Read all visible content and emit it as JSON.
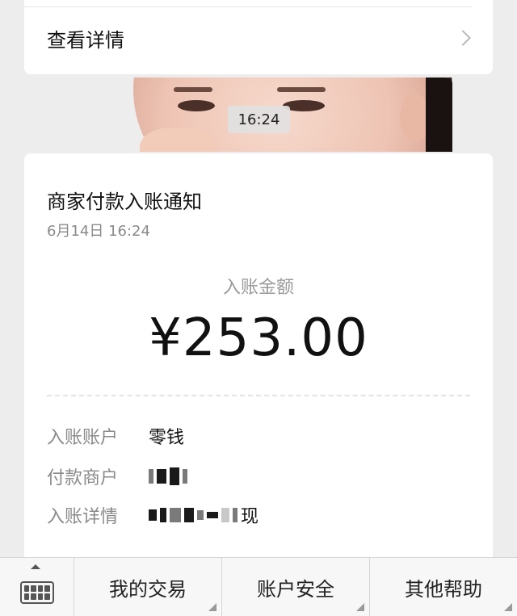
{
  "top_card": {
    "view_details_label": "查看详情"
  },
  "photo_timestamp": "16:24",
  "notice": {
    "title": "商家付款入账通知",
    "date": "6月14日  16:24",
    "amount_label": "入账金额",
    "amount_value": "¥253.00",
    "rows": [
      {
        "key": "入账账户",
        "value": "零钱"
      },
      {
        "key": "付款商户",
        "value": ""
      },
      {
        "key": "入账详情",
        "value": "现"
      }
    ]
  },
  "bottom_menu": {
    "items": [
      "我的交易",
      "账户安全",
      "其他帮助"
    ]
  }
}
